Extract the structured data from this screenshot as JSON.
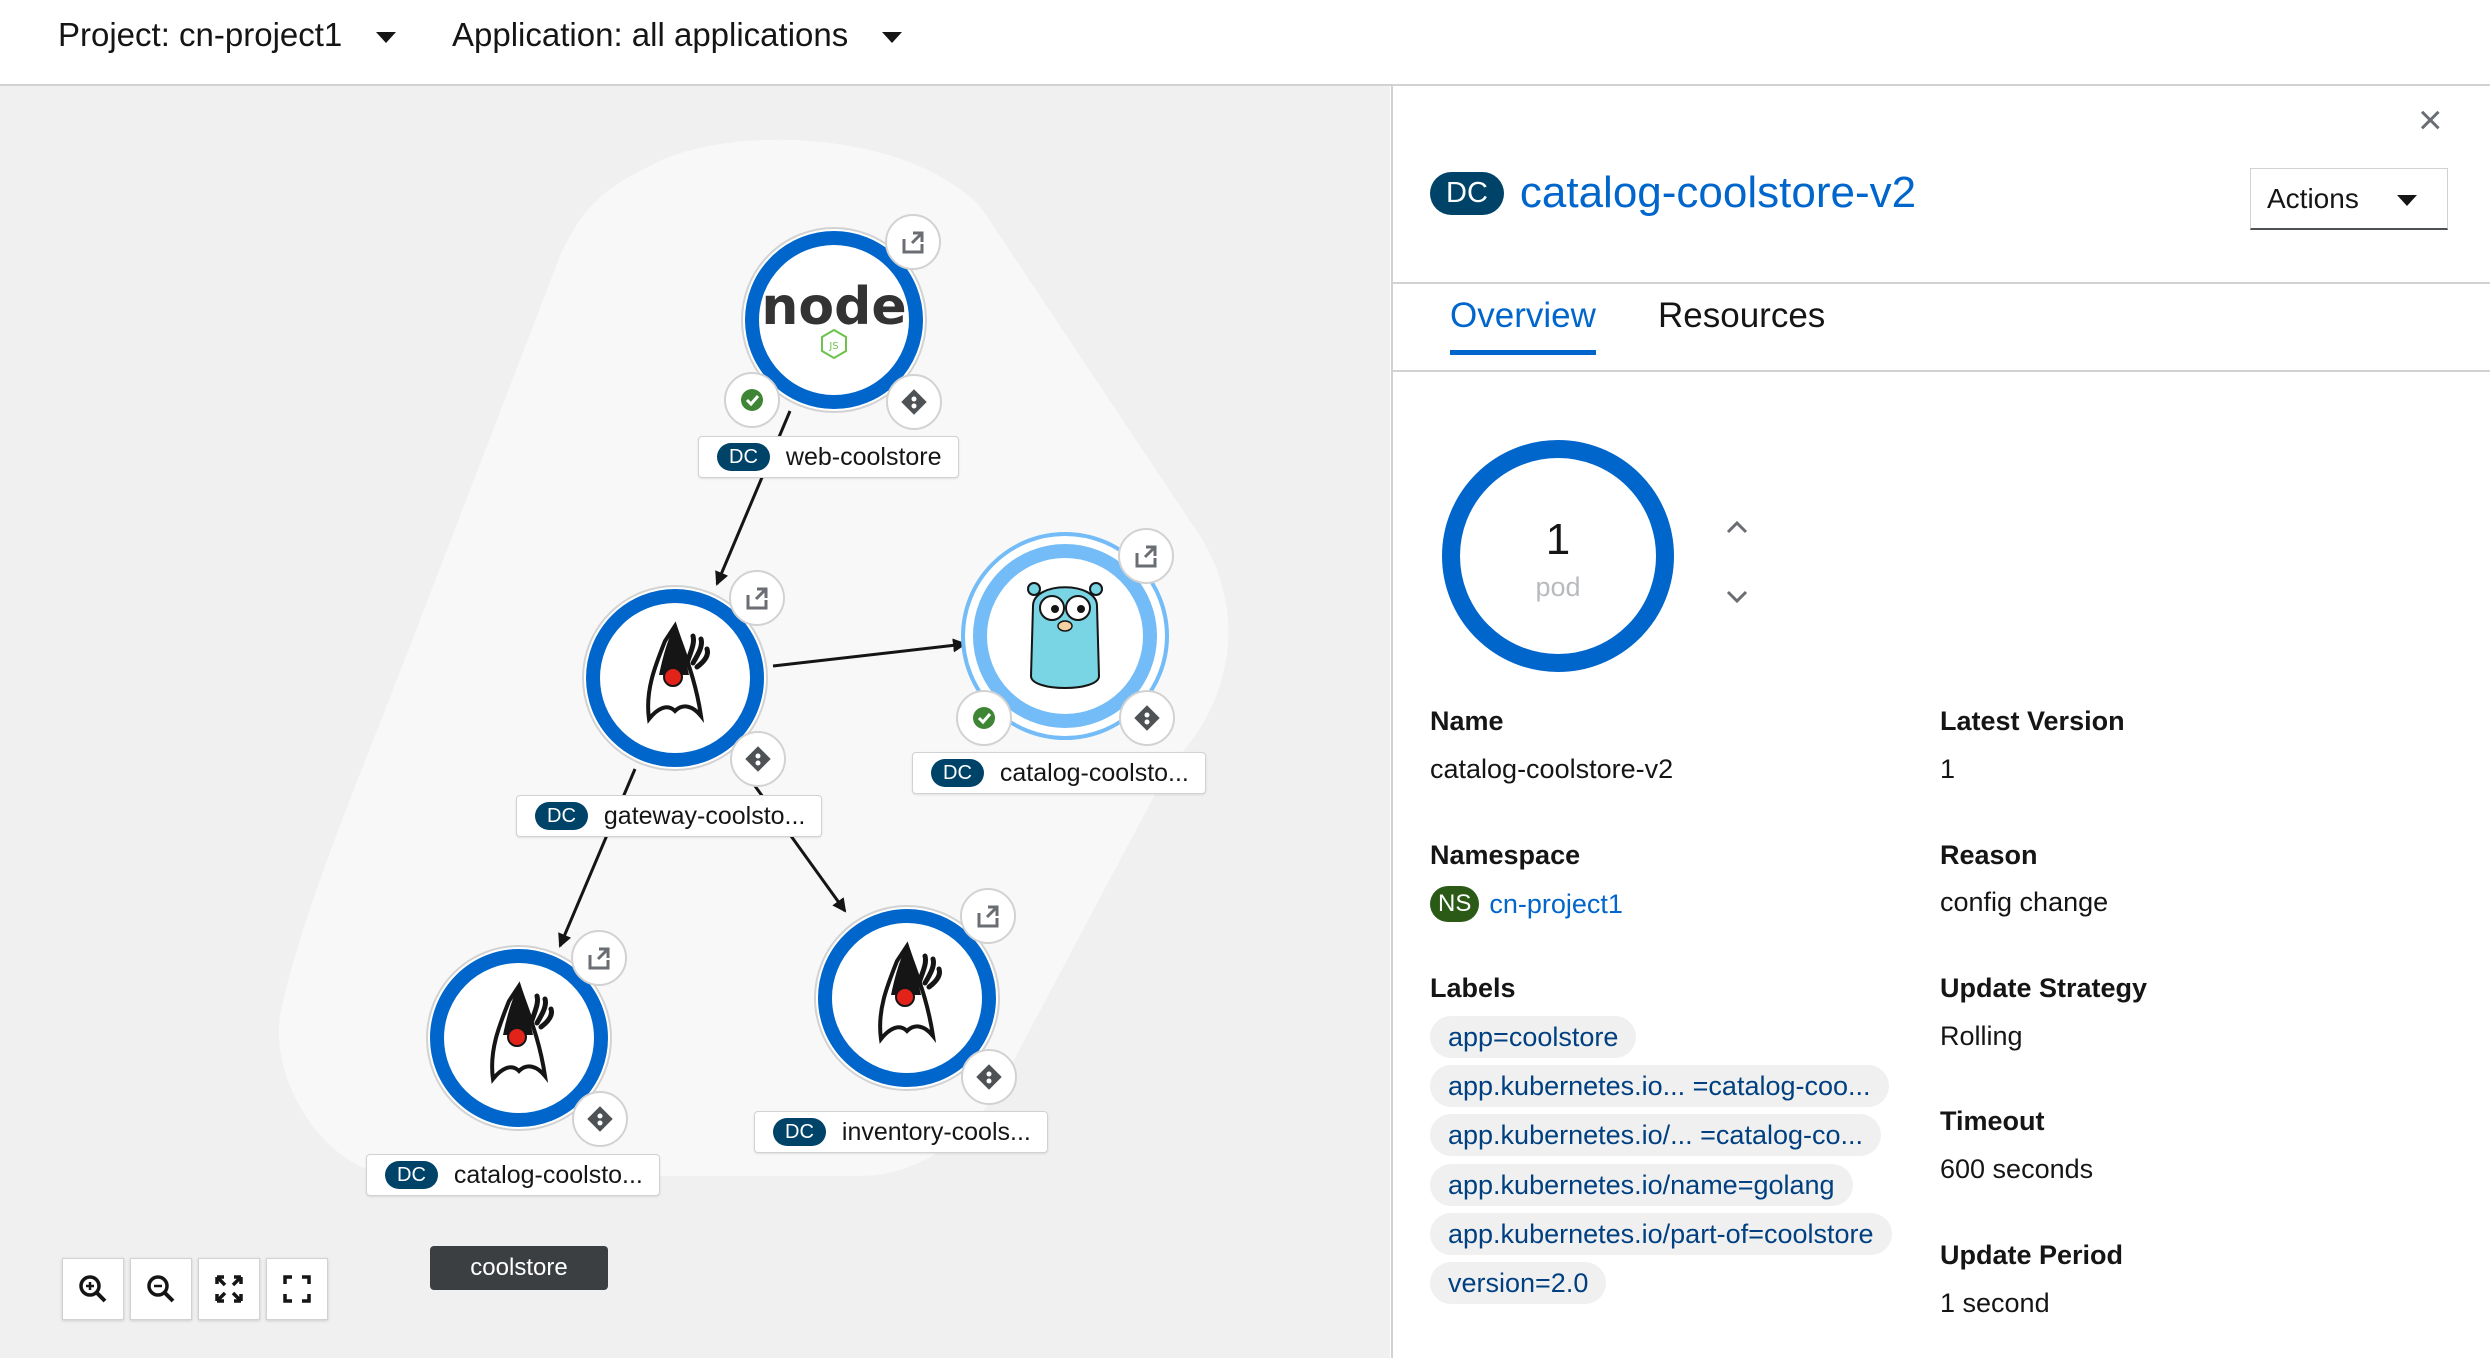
{
  "topbar": {
    "project": "Project: cn-project1",
    "application": "Application: all applications"
  },
  "topology": {
    "group_label": "coolstore",
    "nodes": [
      {
        "badge": "DC",
        "name": "web-coolstore",
        "icon": "nodejs-icon"
      },
      {
        "badge": "DC",
        "name": "gateway-coolsto...",
        "icon": "java-duke-icon"
      },
      {
        "badge": "DC",
        "name": "catalog-coolsto...",
        "icon": "golang-gopher-icon",
        "selected": true
      },
      {
        "badge": "DC",
        "name": "catalog-coolsto...",
        "icon": "java-duke-icon"
      },
      {
        "badge": "DC",
        "name": "inventory-cools...",
        "icon": "java-duke-icon"
      }
    ],
    "toolbar": [
      "zoom-in-icon",
      "zoom-out-icon",
      "fit-to-screen-icon",
      "reset-view-icon"
    ],
    "colors": {
      "ring": "#0066cc",
      "selected_ring": "#73bcf7",
      "status_ok": "#3e8635",
      "badge": "#004368"
    }
  },
  "panel": {
    "badge": "DC",
    "title": "catalog-coolstore-v2",
    "actions_label": "Actions",
    "tabs": [
      "Overview",
      "Resources"
    ],
    "active_tab": "Overview",
    "pods": {
      "count": "1",
      "label": "pod"
    },
    "details": {
      "name_label": "Name",
      "name": "catalog-coolstore-v2",
      "namespace_label": "Namespace",
      "ns_badge": "NS",
      "namespace": "cn-project1",
      "labels_label": "Labels",
      "labels": [
        "app=coolstore",
        "app.kubernetes.io... =catalog-coo...",
        "app.kubernetes.io/... =catalog-co...",
        "app.kubernetes.io/name=golang",
        "app.kubernetes.io/part-of=coolstore",
        "version=2.0"
      ],
      "latest_version_label": "Latest Version",
      "latest_version": "1",
      "reason_label": "Reason",
      "reason": "config change",
      "update_strategy_label": "Update Strategy",
      "update_strategy": "Rolling",
      "timeout_label": "Timeout",
      "timeout": "600 seconds",
      "update_period_label": "Update Period",
      "update_period": "1 second"
    }
  }
}
